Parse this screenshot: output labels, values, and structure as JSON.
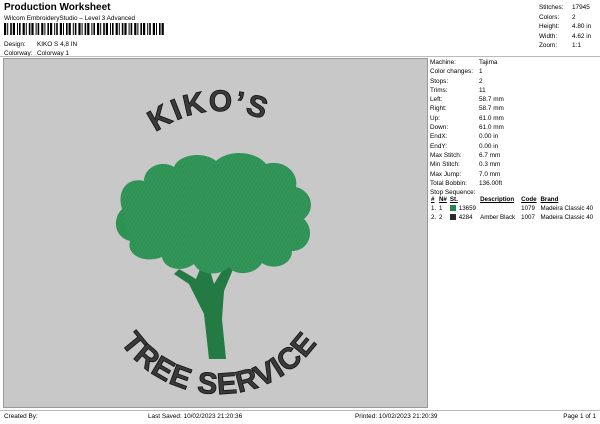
{
  "header": {
    "title": "Production Worksheet",
    "subtitle": "Wilcom EmbroideryStudio – Level 3 Advanced",
    "design_label": "Design:",
    "design_value": "KIKO S 4,8 IN",
    "colorway_label": "Colorway:",
    "colorway_value": "Colorway 1"
  },
  "stats": [
    {
      "label": "Stitches:",
      "value": "17945"
    },
    {
      "label": "Colors:",
      "value": "2"
    },
    {
      "label": "Height:",
      "value": "4.80 in"
    },
    {
      "label": "Width:",
      "value": "4.62 in"
    },
    {
      "label": "Zoom:",
      "value": "1:1"
    }
  ],
  "machine_info": [
    {
      "label": "Machine:",
      "value": "Tajima"
    },
    {
      "label": "Color changes:",
      "value": "1"
    },
    {
      "label": "Stops:",
      "value": "2"
    },
    {
      "label": "Trims:",
      "value": "11"
    },
    {
      "label": "Left:",
      "value": "58.7 mm"
    },
    {
      "label": "Right:",
      "value": "58.7 mm"
    },
    {
      "label": "Up:",
      "value": "61.0 mm"
    },
    {
      "label": "Down:",
      "value": "61.0 mm"
    },
    {
      "label": "EndX:",
      "value": "0.00 in"
    },
    {
      "label": "EndY:",
      "value": "0.00 in"
    },
    {
      "label": "Max Stitch:",
      "value": "6.7 mm"
    },
    {
      "label": "Min Stitch:",
      "value": "0.3 mm"
    },
    {
      "label": "Max Jump:",
      "value": "7.0 mm"
    },
    {
      "label": "Total Bobbin:",
      "value": "136.00ft"
    }
  ],
  "stop_sequence": {
    "title": "Stop Sequence:",
    "columns": [
      "#",
      "N#",
      "St.",
      "Description",
      "Code",
      "Brand"
    ],
    "rows": [
      {
        "num": "1.",
        "n": "1",
        "swatch": "#1e8a4c",
        "st": "13659",
        "desc": "",
        "code": "1079",
        "brand": "Madeira Classic 40"
      },
      {
        "num": "2.",
        "n": "2",
        "swatch": "#2b2b2b",
        "st": "4284",
        "desc": "Amber Black",
        "code": "1007",
        "brand": "Madeira Classic 40"
      }
    ]
  },
  "artwork": {
    "top_text": "KIKO’S",
    "bottom_text": "TREE SERVICE",
    "tree_color": "#2e9255",
    "text_color": "#3a3a3a"
  },
  "footer": {
    "created_by": "Created By:",
    "last_saved": "Last Saved: 10/02/2023 21:20:36",
    "printed": "Printed: 10/02/2023 21:20:39",
    "page": "Page 1 of 1"
  }
}
